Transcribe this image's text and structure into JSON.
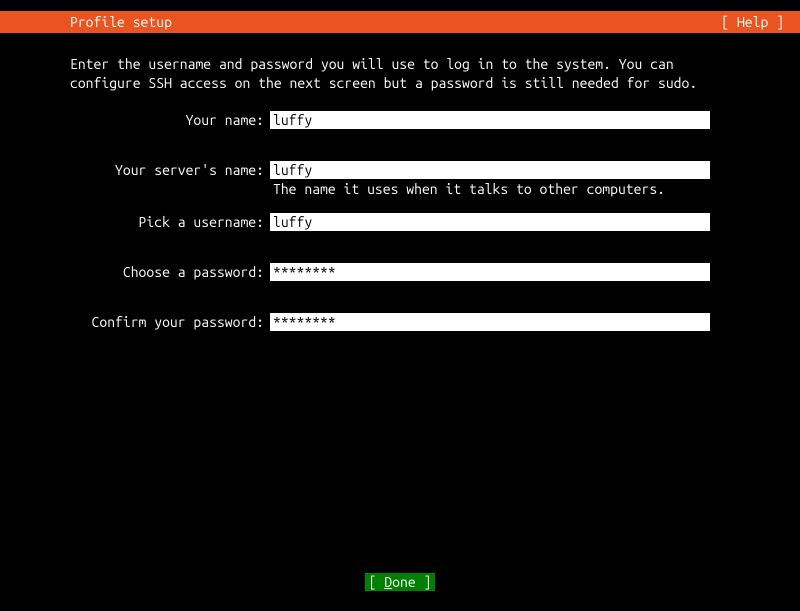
{
  "header": {
    "title": "Profile setup",
    "help": "[ Help ]"
  },
  "intro": "Enter the username and password you will use to log in to the system. You can configure SSH access on the next screen but a password is still needed for sudo.",
  "fields": {
    "your_name": {
      "label": "Your name:",
      "value": "luffy"
    },
    "server_name": {
      "label": "Your server's name:",
      "value": "luffy",
      "hint": "The name it uses when it talks to other computers."
    },
    "username": {
      "label": "Pick a username:",
      "value": "luffy"
    },
    "password": {
      "label": "Choose a password:",
      "value": "********"
    },
    "confirm_password": {
      "label": "Confirm your password:",
      "value": "********"
    }
  },
  "footer": {
    "done_prefix": "[ ",
    "done_char": "D",
    "done_rest": "one",
    "done_suffix": "    ]"
  }
}
